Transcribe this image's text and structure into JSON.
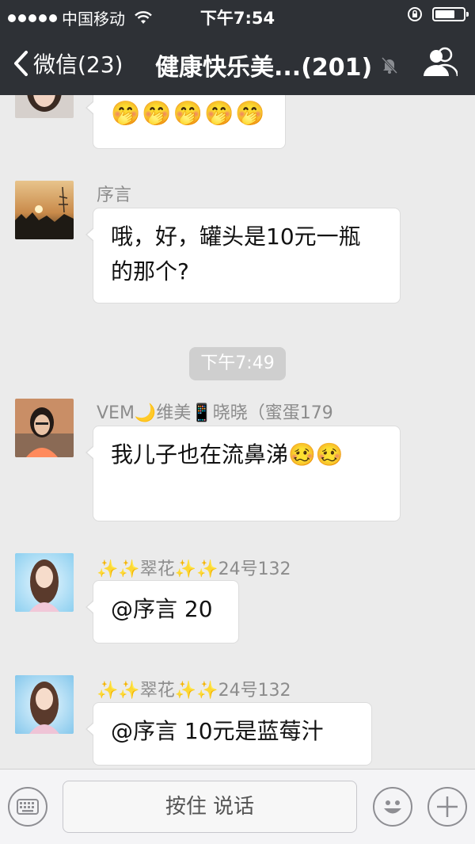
{
  "status_bar": {
    "carrier": "中国移动",
    "time": "下午7:54",
    "icons": [
      "signal-dots",
      "wifi-icon",
      "rotation-lock-icon",
      "battery-icon"
    ]
  },
  "nav": {
    "back_label": "微信(23)",
    "title": "健康快乐美...(201)",
    "icons": [
      "back-chevron-icon",
      "mute-bell-icon",
      "group-members-icon"
    ]
  },
  "messages": [
    {
      "id": "m1",
      "sender": "",
      "text": "🤭🤭🤭🤭🤭"
    },
    {
      "id": "m2",
      "sender": "序言",
      "text": "哦，好，罐头是10元一瓶的那个?"
    },
    {
      "id": "m3",
      "sender": "VEM🌙维美📱晓晓（蜜蛋179",
      "text": "我儿子也在流鼻涕🥴🥴"
    },
    {
      "id": "m4",
      "sender": "✨✨翠花✨✨24号132",
      "text": "@序言 20"
    },
    {
      "id": "m5",
      "sender": "✨✨翠花✨✨24号132",
      "text": "@序言 10元是蓝莓汁"
    }
  ],
  "timestamp_divider": "下午7:49",
  "input_bar": {
    "hold_to_talk_label": "按住 说话",
    "icons": [
      "keyboard-icon",
      "emoji-icon",
      "plus-icon"
    ]
  },
  "colors": {
    "header_bg": "#2e3136",
    "chat_bg": "#ebebeb",
    "bubble_bg": "#ffffff",
    "time_pill_bg": "#cfcfcf"
  }
}
